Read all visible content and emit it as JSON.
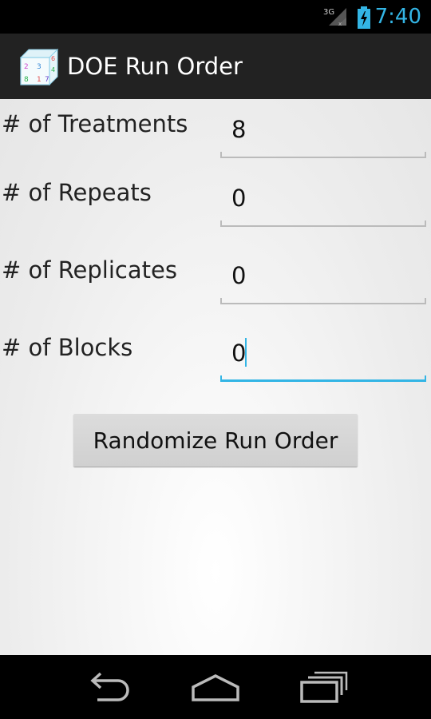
{
  "status_bar": {
    "network_label": "3G",
    "time": "7:40",
    "accent_color": "#33b5e5"
  },
  "action_bar": {
    "app_icon": "doe-cube-icon",
    "title": "DOE Run Order"
  },
  "form": {
    "fields": [
      {
        "label": "# of Treatments",
        "value": "8",
        "focused": false
      },
      {
        "label": "# of Repeats",
        "value": "0",
        "focused": false
      },
      {
        "label": "# of Replicates",
        "value": "0",
        "focused": false
      },
      {
        "label": "# of Blocks",
        "value": "0",
        "focused": true
      }
    ],
    "submit_label": "Randomize Run Order"
  },
  "nav_bar": {
    "buttons": [
      "back-icon",
      "home-icon",
      "recent-apps-icon"
    ]
  }
}
